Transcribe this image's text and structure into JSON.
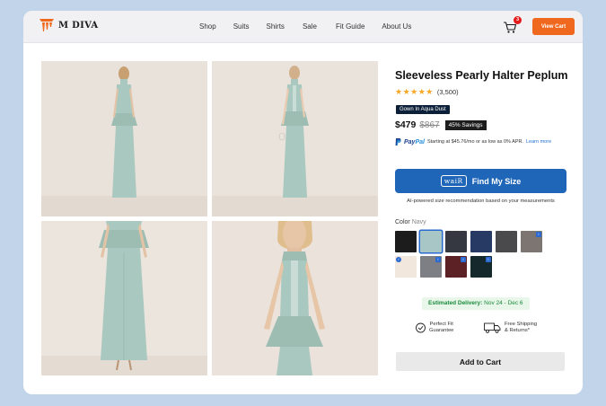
{
  "brand": {
    "name": "M DIVA",
    "logo_icon": "m-diva-logo-icon",
    "accent": "#f0681d"
  },
  "nav": {
    "items": [
      "Shop",
      "Suits",
      "Shirts",
      "Sale",
      "Fit Guide",
      "About Us"
    ]
  },
  "cart": {
    "count": "3",
    "view_cart_label": "View Cart"
  },
  "gallery": {
    "images": [
      {
        "name": "photo-back-view",
        "view": "back"
      },
      {
        "name": "photo-front-view",
        "view": "front"
      },
      {
        "name": "photo-skirt-detail",
        "view": "skirt"
      },
      {
        "name": "photo-bodice-detail",
        "view": "bodice"
      }
    ],
    "dress_color": "#a9c8bf"
  },
  "product": {
    "title": "Sleeveless Pearly Halter Peplum",
    "stars": "★★★★★",
    "reviews": "(3,500)",
    "variant": "Gown In Aqua Dust",
    "price": "$479",
    "compare_price": "$867",
    "savings": "45% Savings"
  },
  "paypal": {
    "logo_a": "Pay",
    "logo_b": "Pal",
    "text": "Starting at $45.76/mo or as low as 0% APR.",
    "link": "Learn more"
  },
  "size": {
    "logo": "waiR",
    "button": "Find My Size",
    "note": "AI-powered size recommendation based on your measurements"
  },
  "color": {
    "label": "Color",
    "selected": "Navy",
    "swatches": [
      {
        "name": "swatch-black",
        "hex": "#1c1c1c"
      },
      {
        "name": "swatch-aqua",
        "hex": "#a8c6c5",
        "active": true
      },
      {
        "name": "swatch-charcoal",
        "hex": "#363841"
      },
      {
        "name": "swatch-navy",
        "hex": "#273a64"
      },
      {
        "name": "swatch-gray",
        "hex": "#4a4a4d"
      },
      {
        "name": "swatch-taupe",
        "hex": "#7d7571",
        "badge": "i"
      },
      {
        "name": "swatch-ivory",
        "hex": "#f1e7dc",
        "badge": "✓",
        "round": true
      },
      {
        "name": "swatch-silver",
        "hex": "#7e7f85",
        "badge": "i"
      },
      {
        "name": "swatch-wine",
        "hex": "#5c2124",
        "badge": "i"
      },
      {
        "name": "swatch-forest",
        "hex": "#15292d",
        "badge": "i"
      }
    ]
  },
  "delivery": {
    "label": "Estimated Delivery:",
    "dates": "Nov 24 - Dec 6"
  },
  "features": [
    {
      "icon": "shield-check-icon",
      "line1": "Perfect Fit",
      "line2": "Guarantee"
    },
    {
      "icon": "truck-icon",
      "line1": "Free Shipping",
      "line2": "& Returns*"
    }
  ],
  "add_to_cart": "Add to Cart"
}
